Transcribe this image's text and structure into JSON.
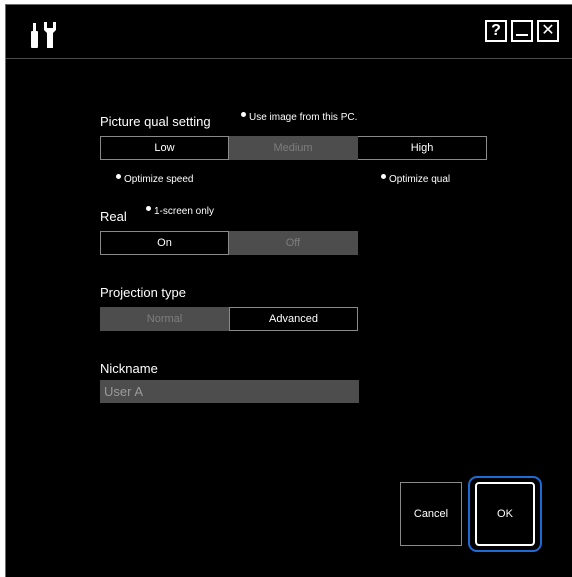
{
  "titlebar": {
    "help_label": "?",
    "minimize_label": "—",
    "close_label": "✕"
  },
  "picture_quality": {
    "label": "Picture qual setting",
    "note": "Use image from this PC.",
    "options": [
      "Low",
      "Medium",
      "High"
    ],
    "selected": "Medium",
    "low_hint": "Optimize speed",
    "high_hint": "Optimize qual"
  },
  "real": {
    "label": "Real",
    "note": "1-screen only",
    "options": [
      "On",
      "Off"
    ],
    "selected": "Off"
  },
  "projection_type": {
    "label": "Projection type",
    "options": [
      "Normal",
      "Advanced"
    ],
    "selected": "Normal"
  },
  "nickname": {
    "label": "Nickname",
    "value": "User A"
  },
  "actions": {
    "cancel_label": "Cancel",
    "ok_label": "OK"
  },
  "colors": {
    "background": "#000000",
    "selected_segment": "#4d4d4d",
    "focus_ring": "#1f6bd6"
  }
}
